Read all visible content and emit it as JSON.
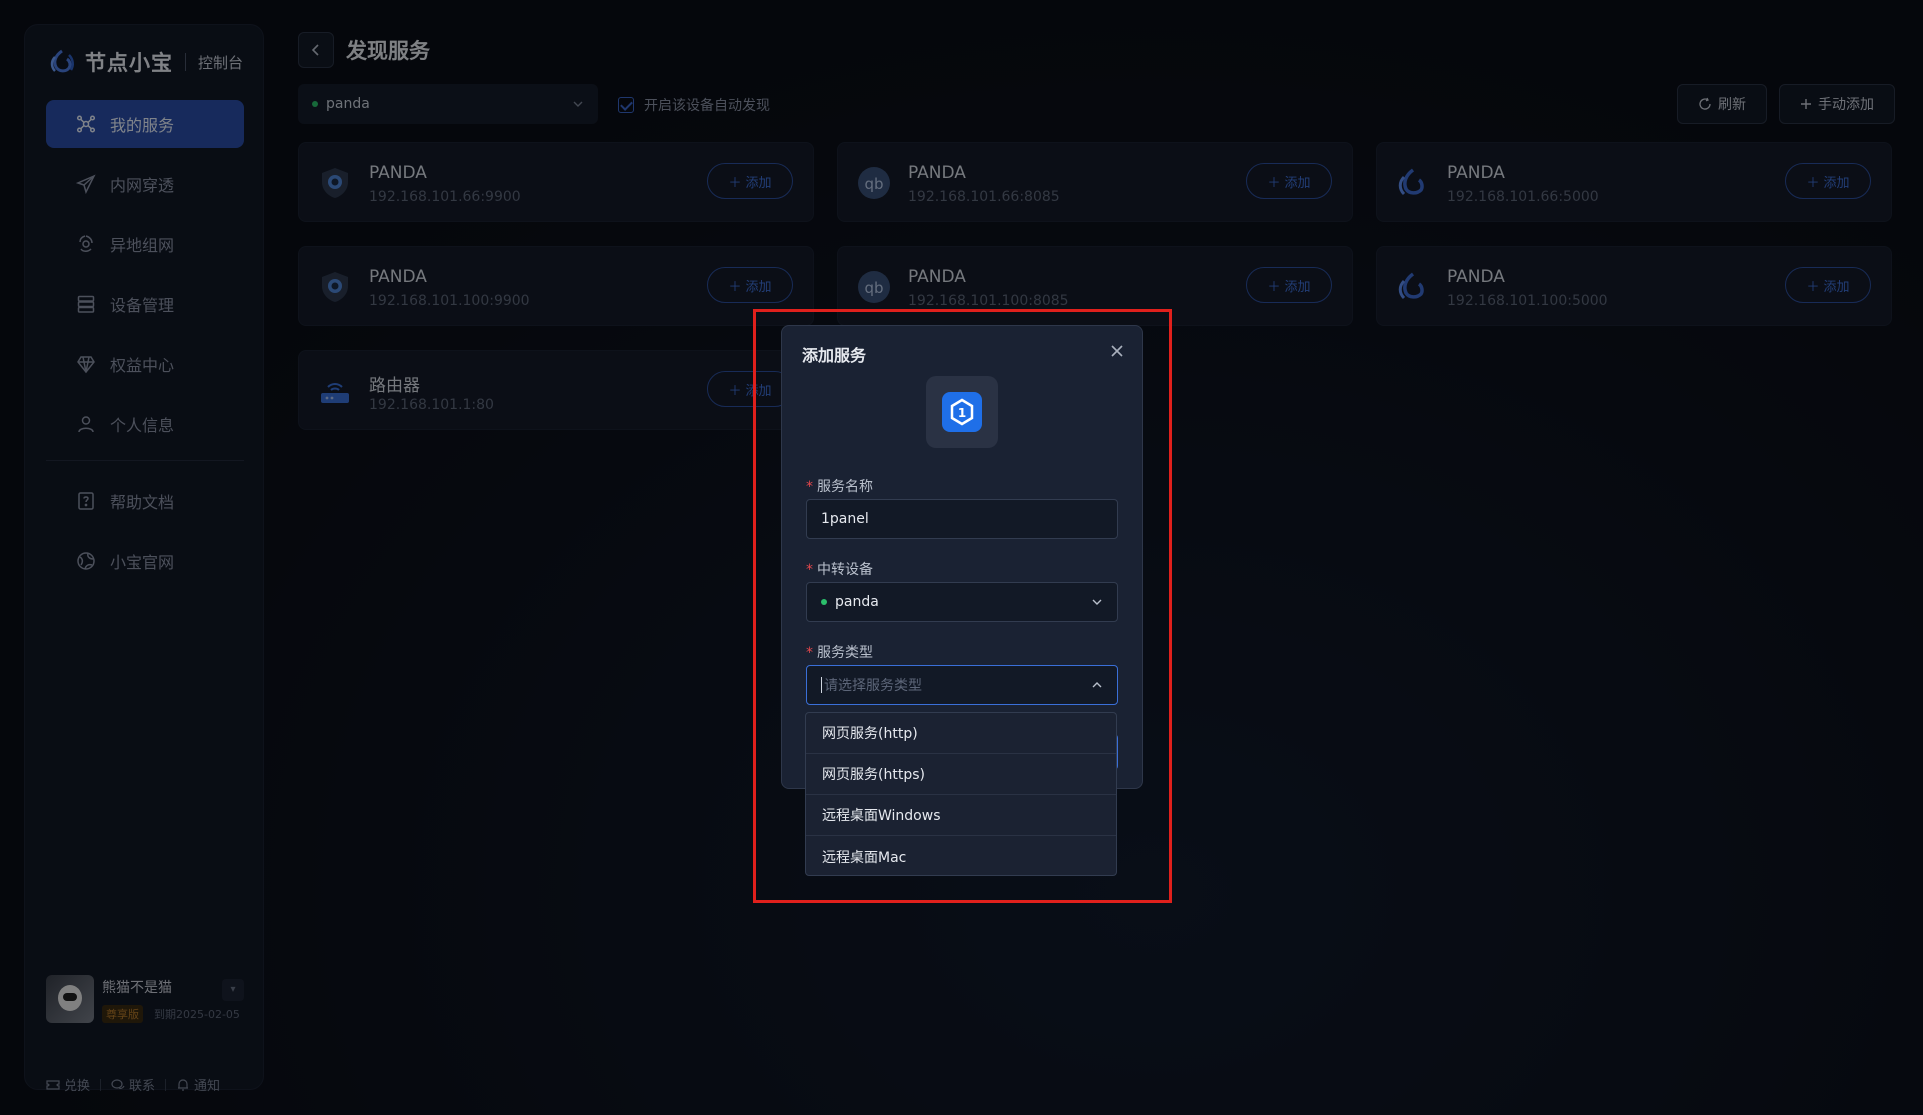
{
  "brand": {
    "name": "节点小宝",
    "sub": "控制台"
  },
  "sidebar": {
    "items": [
      {
        "label": "我的服务",
        "icon": "network-icon",
        "active": true
      },
      {
        "label": "内网穿透",
        "icon": "send-icon"
      },
      {
        "label": "异地组网",
        "icon": "mesh-icon"
      },
      {
        "label": "设备管理",
        "icon": "server-icon"
      },
      {
        "label": "权益中心",
        "icon": "diamond-icon"
      },
      {
        "label": "个人信息",
        "icon": "user-icon"
      },
      {
        "label": "帮助文档",
        "icon": "help-doc-icon"
      },
      {
        "label": "小宝官网",
        "icon": "globe-icon"
      }
    ]
  },
  "user": {
    "name": "熊猫不是猫",
    "badge": "尊享版",
    "expire": "到期2025-02-05",
    "actions": [
      "兑换",
      "联系",
      "通知"
    ]
  },
  "header": {
    "title": "发现服务"
  },
  "toolbar": {
    "device": "panda",
    "auto_discover_label": "开启该设备自动发现",
    "refresh_label": "刷新",
    "add_manual_label": "手动添加"
  },
  "cards": [
    {
      "title": "PANDA",
      "addr": "192.168.101.66:9900",
      "icon": "shield-icon",
      "add_label": "添加"
    },
    {
      "title": "PANDA",
      "addr": "192.168.101.66:8085",
      "icon": "qbittorrent-icon",
      "add_label": "添加"
    },
    {
      "title": "PANDA",
      "addr": "192.168.101.66:5000",
      "icon": "brand-logo-icon",
      "add_label": "添加"
    },
    {
      "title": "PANDA",
      "addr": "192.168.101.100:9900",
      "icon": "shield-icon",
      "add_label": "添加"
    },
    {
      "title": "PANDA",
      "addr": "192.168.101.100:8085",
      "icon": "qbittorrent-icon",
      "add_label": "添加"
    },
    {
      "title": "PANDA",
      "addr": "192.168.101.100:5000",
      "icon": "brand-logo-icon",
      "add_label": "添加"
    },
    {
      "title": "路由器",
      "addr": "192.168.101.1:80",
      "icon": "router-icon",
      "add_label": "添加"
    }
  ],
  "modal": {
    "title": "添加服务",
    "service_icon": "1panel-icon",
    "fields": {
      "name_label": "服务名称",
      "name_value": "1panel",
      "relay_label": "中转设备",
      "relay_value": "panda",
      "type_label": "服务类型",
      "type_placeholder": "请选择服务类型"
    },
    "dropdown_options": [
      "网页服务(http)",
      "网页服务(https)",
      "远程桌面Windows",
      "远程桌面Mac"
    ]
  },
  "colors": {
    "accent": "#2a4ea8",
    "link": "#3f6fd8",
    "highlight": "#e0201c",
    "online": "#2bbf6b"
  }
}
